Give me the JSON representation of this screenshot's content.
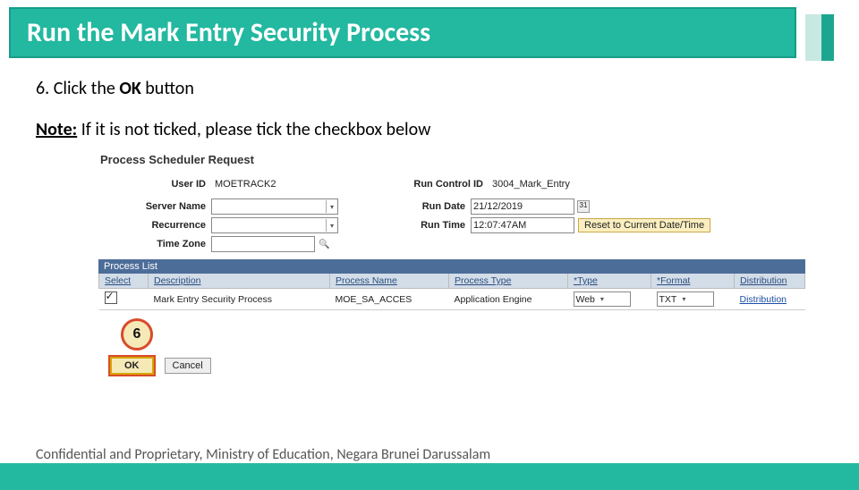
{
  "slide": {
    "title": "Run the Mark Entry Security Process",
    "step_prefix": "6. Click the ",
    "step_bold": "OK",
    "step_suffix": " button",
    "note_label": "Note:",
    "note_text": " If it is not ticked, please tick the checkbox below",
    "callout_number": "6",
    "footer": "Confidential and Proprietary, Ministry of Education, Negara Brunei Darussalam"
  },
  "scheduler": {
    "heading": "Process Scheduler Request",
    "labels": {
      "user_id": "User ID",
      "run_control_id": "Run Control ID",
      "server_name": "Server Name",
      "recurrence": "Recurrence",
      "time_zone": "Time Zone",
      "run_date": "Run Date",
      "run_time": "Run Time"
    },
    "values": {
      "user_id": "MOETRACK2",
      "run_control_id": "3004_Mark_Entry",
      "run_date": "21/12/2019",
      "run_time": "12:07:47AM"
    },
    "reset_btn": "Reset to Current Date/Time",
    "process_list_label": "Process List",
    "columns": {
      "select": "Select",
      "description": "Description",
      "process_name": "Process Name",
      "process_type": "Process Type",
      "type": "Type",
      "format": "Format",
      "distribution": "Distribution"
    },
    "row": {
      "description": "Mark Entry Security Process",
      "process_name": "MOE_SA_ACCES",
      "process_type": "Application Engine",
      "type": "Web",
      "format": "TXT",
      "distribution": "Distribution"
    },
    "buttons": {
      "ok": "OK",
      "cancel": "Cancel"
    }
  }
}
